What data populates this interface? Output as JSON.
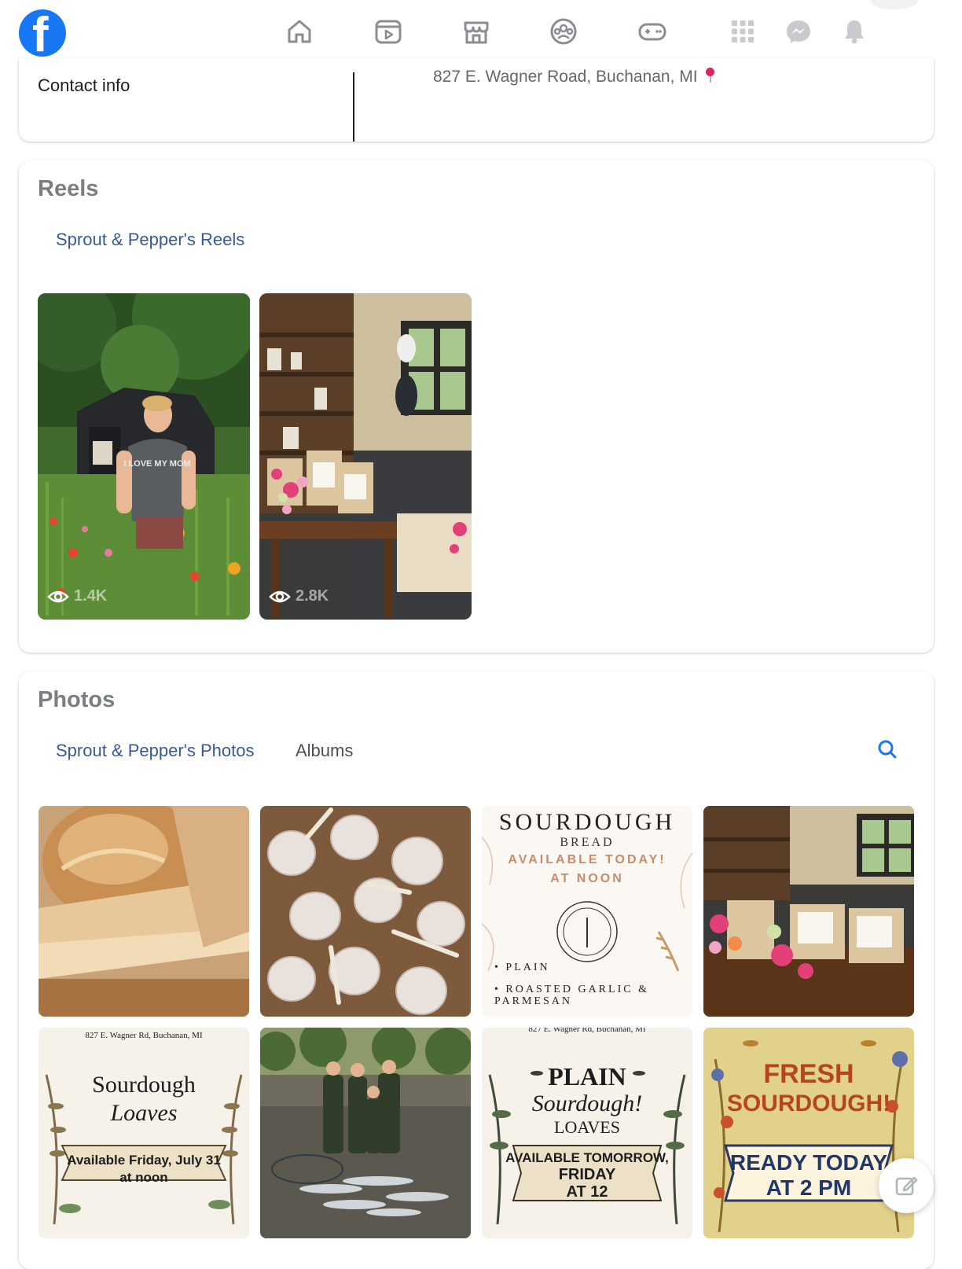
{
  "nav": {
    "logo_letter": "f",
    "icons": [
      "home-icon",
      "watch-icon",
      "marketplace-icon",
      "groups-icon",
      "gaming-icon",
      "menu-grid-icon",
      "messenger-icon",
      "notifications-icon"
    ]
  },
  "contact": {
    "label": "Contact info",
    "address": "827 E. Wagner Road, Buchanan, MI"
  },
  "reels": {
    "title": "Reels",
    "tab_label": "Sprout & Pepper's Reels",
    "items": [
      {
        "views": "1.4K",
        "shirt_text": "I LOVE MY MOM"
      },
      {
        "views": "2.8K"
      }
    ]
  },
  "photos": {
    "title": "Photos",
    "tabs": [
      "Sprout & Pepper's Photos",
      "Albums"
    ],
    "items": [
      {
        "kind": "bread-photo"
      },
      {
        "kind": "garlic-photo"
      },
      {
        "kind": "poster",
        "lines": [
          "SOURDOUGH",
          "BREAD",
          "AVAILABLE TODAY!",
          "AT NOON",
          "• PLAIN",
          "• ROASTED GARLIC &",
          "PARMESAN"
        ]
      },
      {
        "kind": "shop-photo"
      },
      {
        "kind": "poster",
        "lines": [
          "827 E. Wagner Rd, Buchanan, MI",
          "Sourdough",
          "Loaves",
          "Available Friday, July 31",
          "at noon"
        ]
      },
      {
        "kind": "fishing-photo"
      },
      {
        "kind": "poster",
        "lines": [
          "827 E. Wagner Rd, Buchanan, MI",
          "PLAIN",
          "Sourdough!",
          "LOAVES",
          "AVAILABLE TOMORROW,",
          "FRIDAY",
          "AT 12"
        ]
      },
      {
        "kind": "poster",
        "lines": [
          "FRESH",
          "SOURDOUGH!",
          "READY TODAY",
          "AT 2 PM"
        ]
      }
    ]
  },
  "colors": {
    "brand": "#1877f2",
    "link": "#385898",
    "pin": "#e0245e"
  }
}
